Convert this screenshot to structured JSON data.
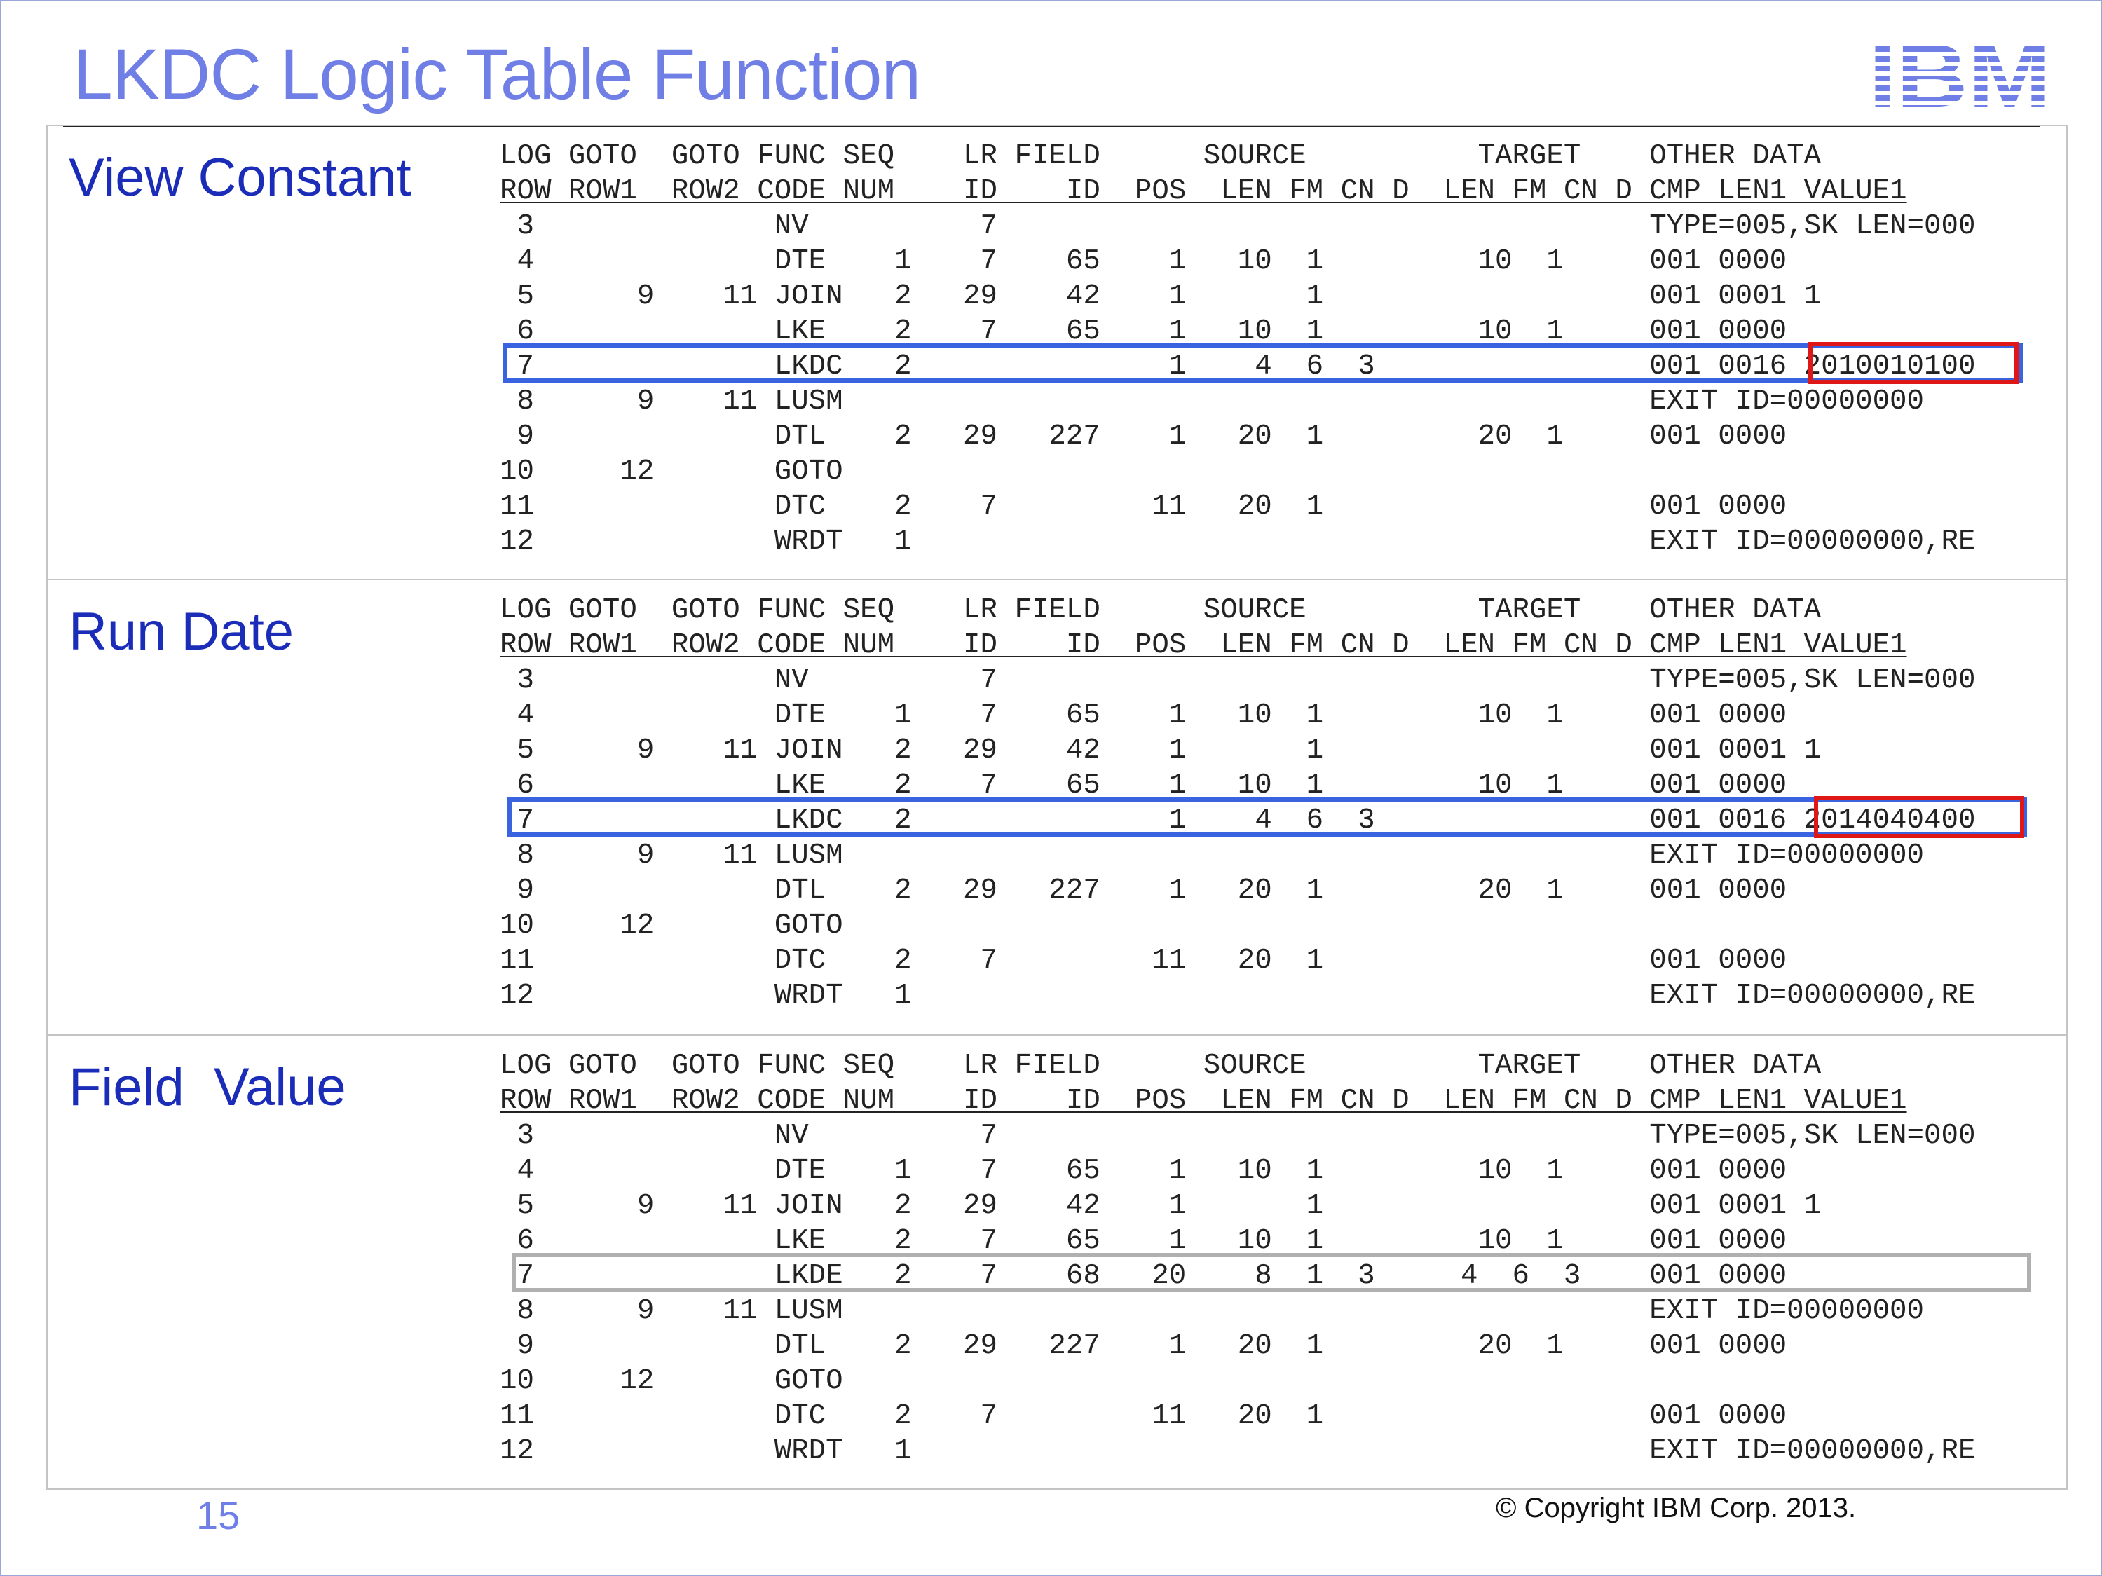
{
  "slide": {
    "title": "LKDC Logic Table Function",
    "page_number": "15",
    "copyright": "© Copyright IBM Corp. 2013.",
    "logo_text": "IBM",
    "colors": {
      "title": "#6f7fe6",
      "section": "#1a2cb8",
      "blue_box": "#3a63e0",
      "red_box": "#e01717",
      "gray_box": "#b0b0b0"
    }
  },
  "sections": [
    {
      "title": "View Constant",
      "lines": [
        "LOG GOTO  GOTO FUNC SEQ    LR FIELD      SOURCE          TARGET    OTHER DATA",
        "ROW ROW1  ROW2 CODE NUM    ID    ID  POS  LEN FM CN D  LEN FM CN D CMP LEN1 VALUE1",
        " 3              NV          7                                      TYPE=005,SK LEN=000",
        " 4              DTE    1    7    65    1   10  1         10  1     001 0000",
        " 5      9    11 JOIN   2   29    42    1       1                   001 0001 1",
        " 6              LKE    2    7    65    1   10  1         10  1     001 0000",
        " 7              LKDC   2               1    4  6  3                001 0016 2010010100",
        " 8      9    11 LUSM                                               EXIT ID=00000000",
        " 9              DTL    2   29   227    1   20  1         20  1     001 0000",
        "10     12       GOTO",
        "11              DTC    2    7         11   20  1                   001 0000",
        "12              WRDT   1                                           EXIT ID=00000000,RE"
      ]
    },
    {
      "title": "Run Date",
      "lines": [
        "LOG GOTO  GOTO FUNC SEQ    LR FIELD      SOURCE          TARGET    OTHER DATA",
        "ROW ROW1  ROW2 CODE NUM    ID    ID  POS  LEN FM CN D  LEN FM CN D CMP LEN1 VALUE1",
        " 3              NV          7                                      TYPE=005,SK LEN=000",
        " 4              DTE    1    7    65    1   10  1         10  1     001 0000",
        " 5      9    11 JOIN   2   29    42    1       1                   001 0001 1",
        " 6              LKE    2    7    65    1   10  1         10  1     001 0000",
        " 7              LKDC   2               1    4  6  3                001 0016 2014040400",
        " 8      9    11 LUSM                                               EXIT ID=00000000",
        " 9              DTL    2   29   227    1   20  1         20  1     001 0000",
        "10     12       GOTO",
        "11              DTC    2    7         11   20  1                   001 0000",
        "12              WRDT   1                                           EXIT ID=00000000,RE"
      ]
    },
    {
      "title": "Field  Value",
      "lines": [
        "LOG GOTO  GOTO FUNC SEQ    LR FIELD      SOURCE          TARGET    OTHER DATA",
        "ROW ROW1  ROW2 CODE NUM    ID    ID  POS  LEN FM CN D  LEN FM CN D CMP LEN1 VALUE1",
        " 3              NV          7                                      TYPE=005,SK LEN=000",
        " 4              DTE    1    7    65    1   10  1         10  1     001 0000",
        " 5      9    11 JOIN   2   29    42    1       1                   001 0001 1",
        " 6              LKE    2    7    65    1   10  1         10  1     001 0000",
        " 7              LKDE   2    7    68   20    8  1  3     4  6  3    001 0000",
        " 8      9    11 LUSM                                               EXIT ID=00000000",
        " 9              DTL    2   29   227    1   20  1         20  1     001 0000",
        "10     12       GOTO",
        "11              DTC    2    7         11   20  1                   001 0000",
        "12              WRDT   1                                           EXIT ID=00000000,RE"
      ]
    }
  ]
}
